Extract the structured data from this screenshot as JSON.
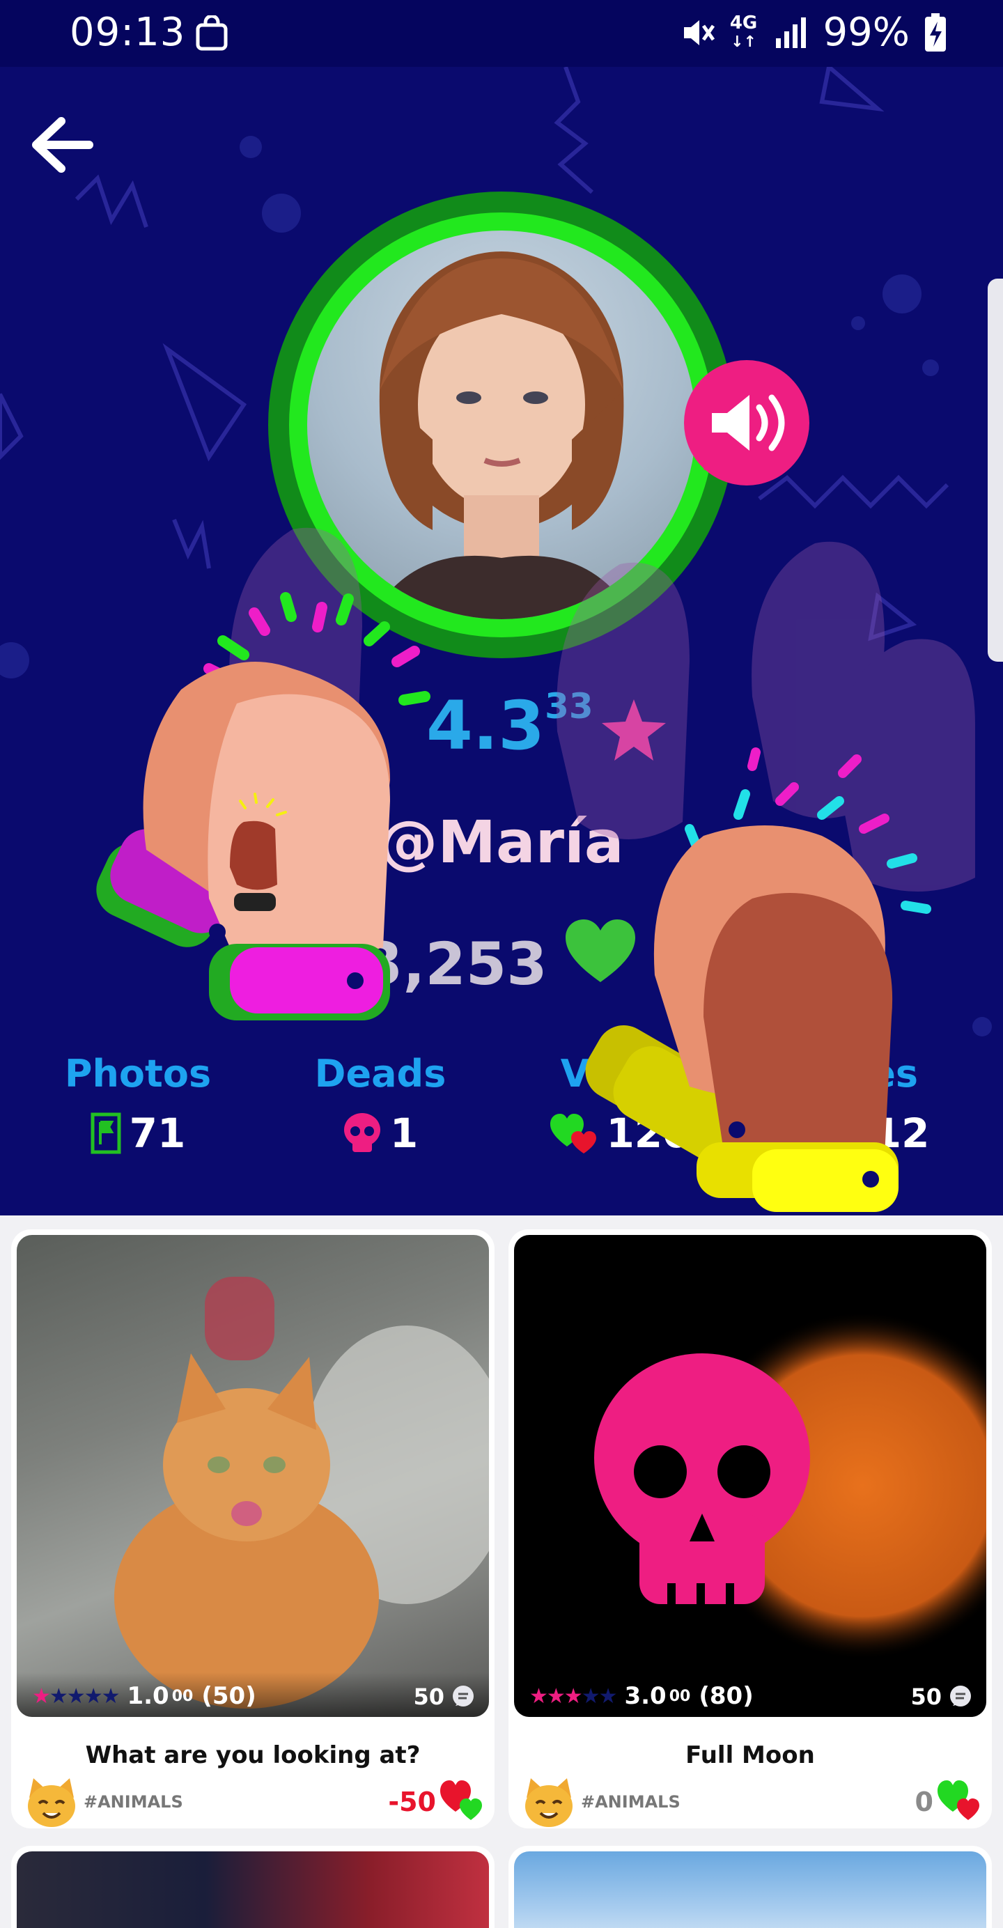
{
  "status_bar": {
    "time": "09:13",
    "network": "4G",
    "battery": "99%"
  },
  "profile": {
    "rating_main": "4.3",
    "rating_decimals": "33",
    "username": "@María",
    "likes": "3,253"
  },
  "stats": [
    {
      "label": "Photos",
      "value": "71",
      "icon": "flag-icon"
    },
    {
      "label": "Deads",
      "value": "1",
      "icon": "skull-icon"
    },
    {
      "label": "Votes",
      "value": "120",
      "icon": "hearts-icon"
    },
    {
      "label": "Likes",
      "value": "412",
      "icon": "likes-icon"
    }
  ],
  "posts": [
    {
      "title": "What are you looking at?",
      "rating_main": "1.0",
      "rating_decimals": "00",
      "rating_count": "(50)",
      "stars_filled": 1,
      "comments": "50",
      "tag": "#ANIMALS",
      "votes": "-50",
      "votes_color": "#e8142c"
    },
    {
      "title": "Full Moon",
      "rating_main": "3.0",
      "rating_decimals": "00",
      "rating_count": "(80)",
      "stars_filled": 3,
      "comments": "50",
      "tag": "#ANIMALS",
      "votes": "0",
      "votes_color": "#8a8a8a"
    }
  ],
  "colors": {
    "background": "#0a0a6e",
    "accent_pink": "#ee1e82",
    "accent_green": "#22e81e",
    "accent_blue": "#1ea3f0"
  }
}
